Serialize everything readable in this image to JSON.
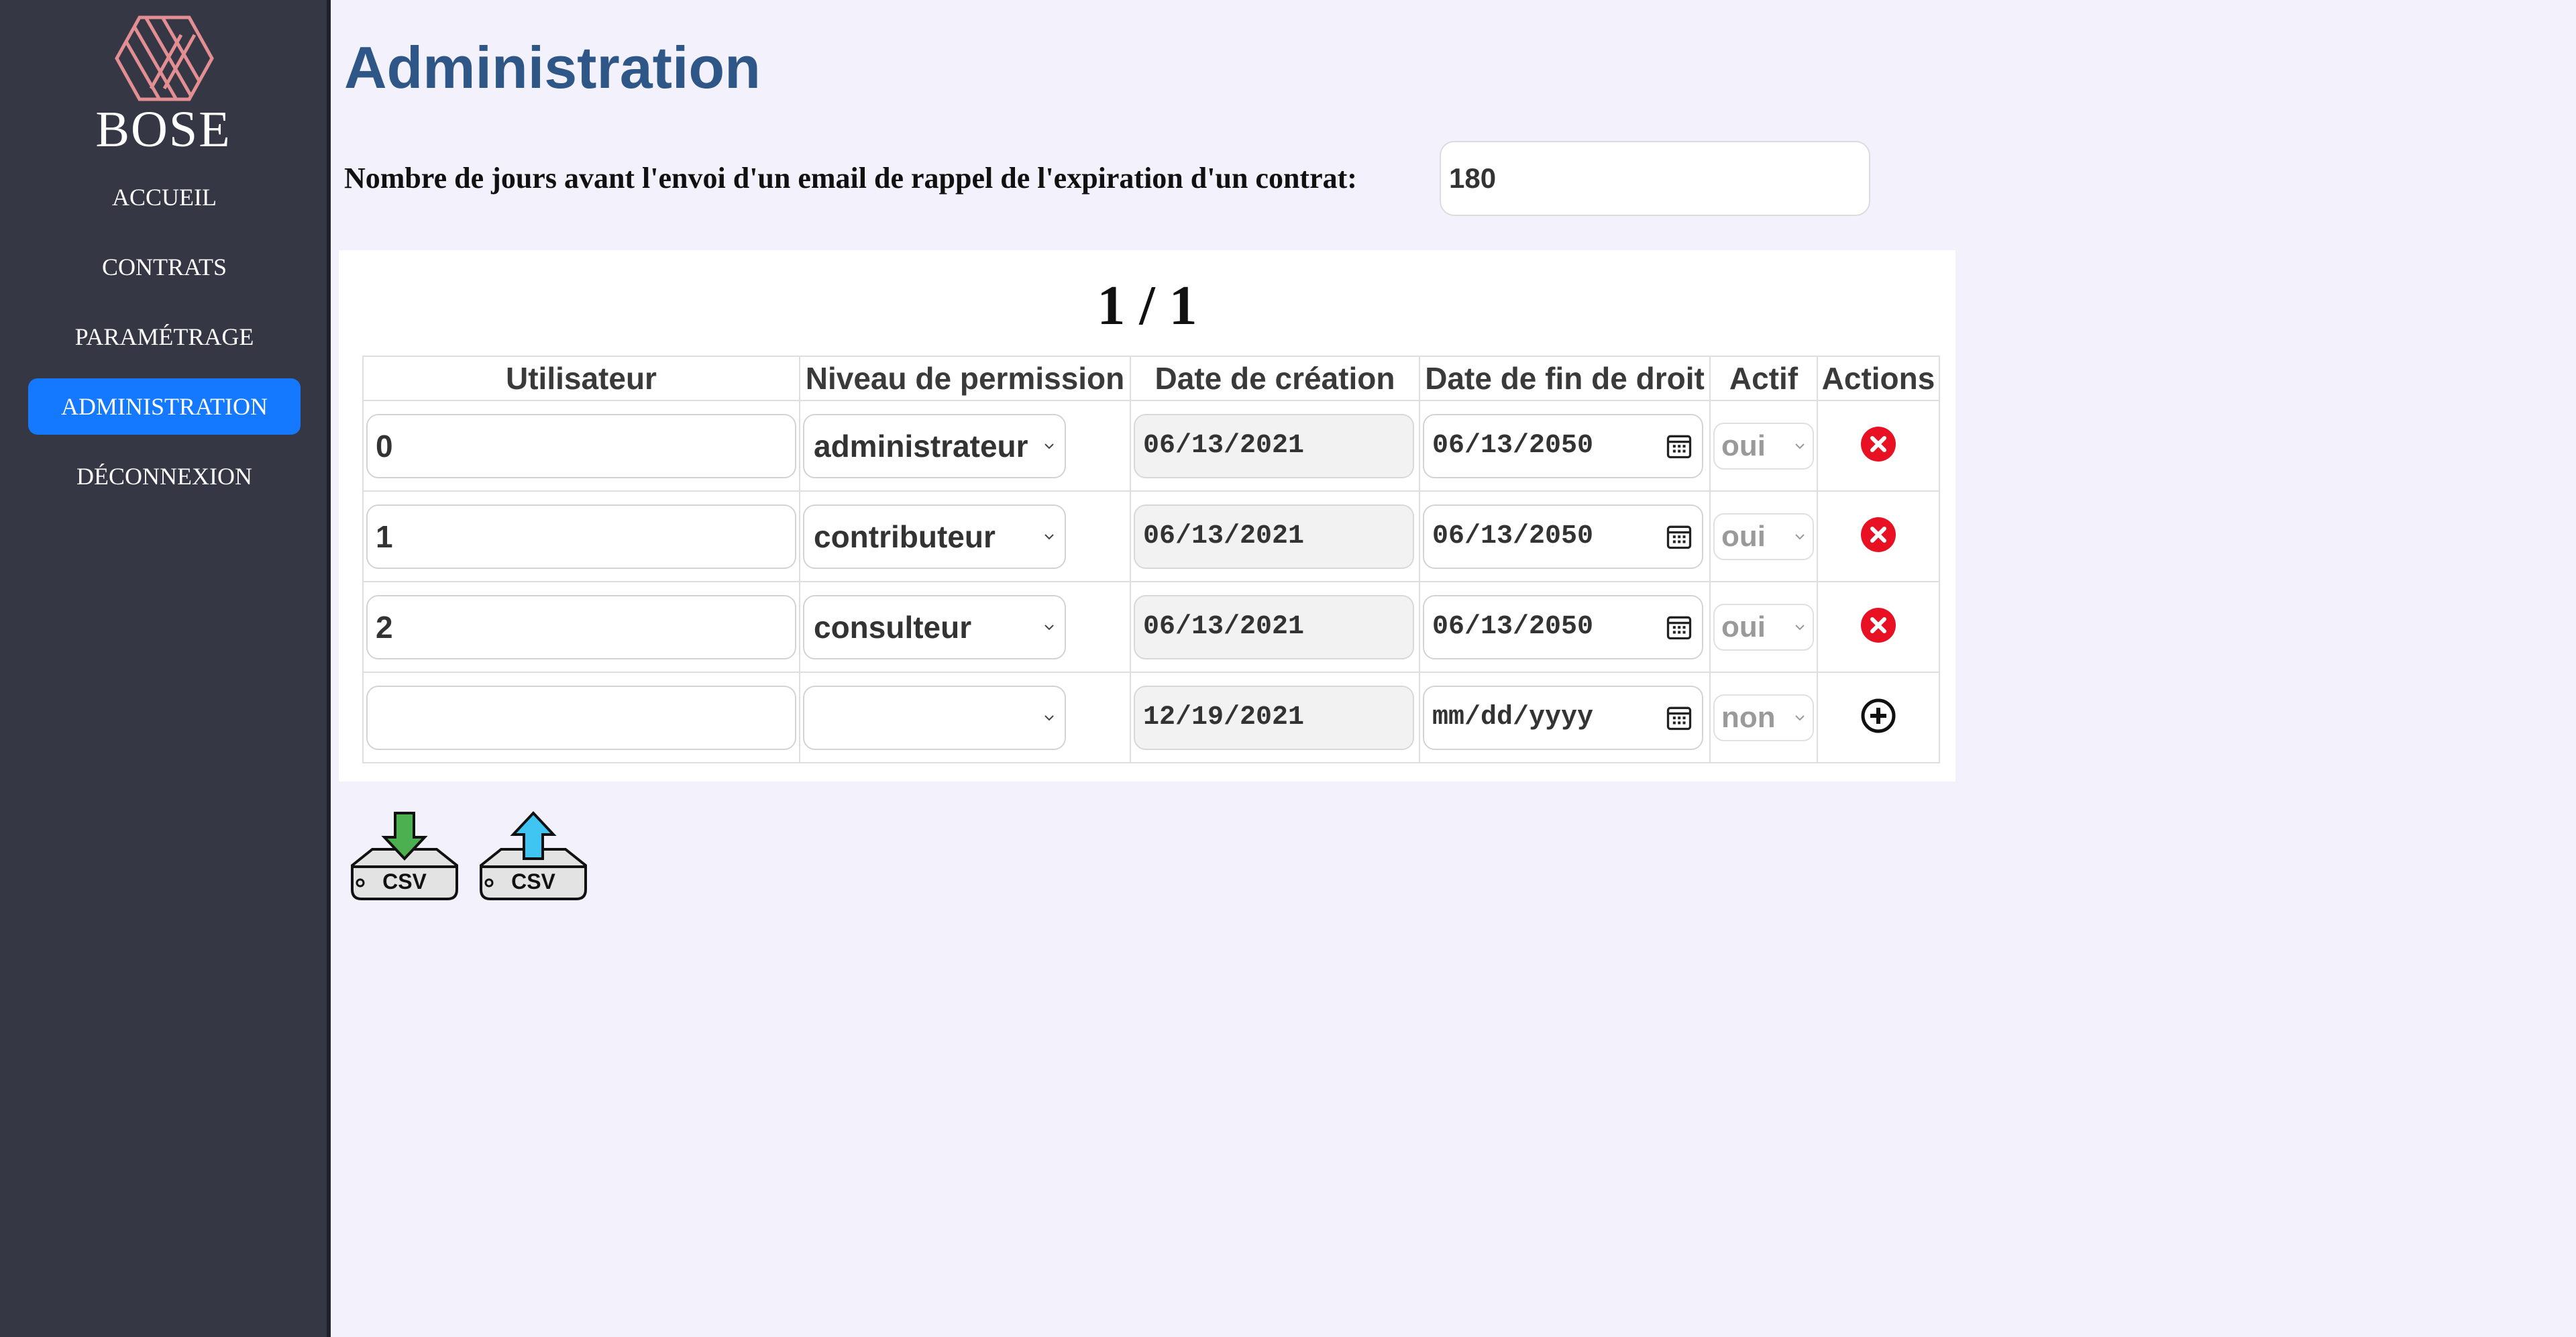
{
  "sidebar": {
    "brand": "BOSE",
    "items": [
      {
        "label": "ACCUEIL"
      },
      {
        "label": "CONTRATS"
      },
      {
        "label": "PARAMÉTRAGE"
      },
      {
        "label": "ADMINISTRATION",
        "active": true
      },
      {
        "label": "DÉCONNEXION"
      }
    ]
  },
  "page": {
    "title": "Administration",
    "reminder_label": "Nombre de jours avant l'envoi d'un email de rappel de l'expiration d'un contrat:",
    "reminder_value": "180"
  },
  "pagination": {
    "text": "1 / 1"
  },
  "table": {
    "headers": [
      "Utilisateur",
      "Niveau de permission",
      "Date de création",
      "Date de fin de droit",
      "Actif",
      "Actions"
    ],
    "rows": [
      {
        "user": "0",
        "permission": "administrateur",
        "created": "06/13/2021",
        "end": "06/13/2050",
        "active": "oui",
        "action": "delete"
      },
      {
        "user": "1",
        "permission": "contributeur",
        "created": "06/13/2021",
        "end": "06/13/2050",
        "active": "oui",
        "action": "delete"
      },
      {
        "user": "2",
        "permission": "consulteur",
        "created": "06/13/2021",
        "end": "06/13/2050",
        "active": "oui",
        "action": "delete"
      }
    ],
    "new_row": {
      "user": "",
      "permission": "",
      "created": "12/19/2021",
      "end_placeholder": "mm/dd/yyyy",
      "active": "non",
      "action": "add"
    }
  },
  "csv": {
    "export_label": "CSV",
    "import_label": "CSV",
    "export_color": "#4caf50",
    "import_color": "#40c4f2"
  },
  "colors": {
    "sidebar_bg": "#353745",
    "active_nav": "#1479ff",
    "title": "#2e5787",
    "delete": "#e81123"
  }
}
